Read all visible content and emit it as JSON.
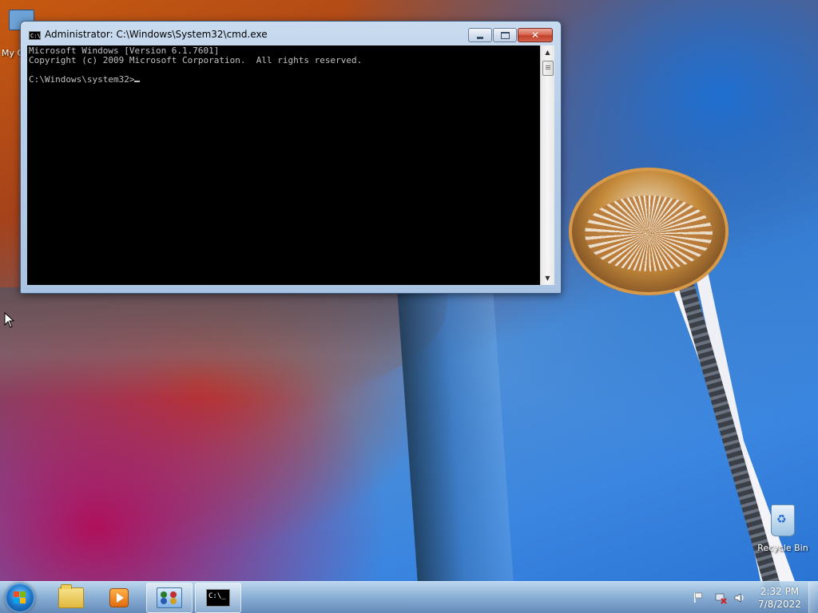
{
  "desktop": {
    "icons": [
      {
        "label": "My C"
      },
      {
        "label": "Recycle Bin"
      }
    ]
  },
  "cmd_window": {
    "title": "Administrator: C:\\Windows\\System32\\cmd.exe",
    "icon_text": "C:\\",
    "console_lines": [
      "Microsoft Windows [Version 6.1.7601]",
      "Copyright (c) 2009 Microsoft Corporation.  All rights reserved.",
      "",
      "C:\\Windows\\system32>"
    ],
    "buttons": {
      "minimize": "minimize-icon",
      "maximize": "maximize-icon",
      "close_glyph": "✕"
    }
  },
  "taskbar": {
    "start": "windows-logo-icon",
    "pinned": [
      {
        "icon": "folder-icon"
      },
      {
        "icon": "media-player-icon"
      },
      {
        "icon": "control-panel-icon"
      },
      {
        "icon": "cmd-icon",
        "label": "C:\\_"
      }
    ],
    "tray": {
      "time": "2:32 PM",
      "date": "7/8/2022"
    }
  },
  "colors": {
    "console_bg": "#000000",
    "console_fg": "#c0c0c0",
    "close_button": "#c2402a"
  }
}
